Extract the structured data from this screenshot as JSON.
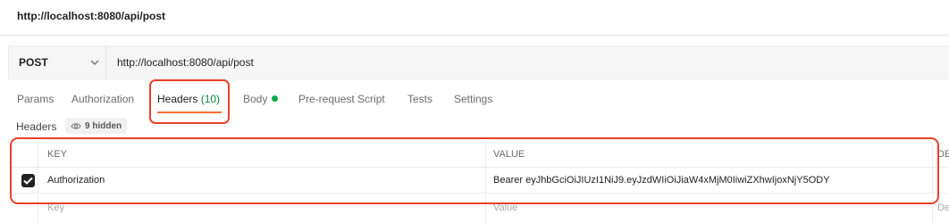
{
  "title": "http://localhost:8080/api/post",
  "request": {
    "method": "POST",
    "url": "http://localhost:8080/api/post"
  },
  "tabs": [
    {
      "label": "Params"
    },
    {
      "label": "Authorization"
    },
    {
      "label": "Headers",
      "count": "(10)"
    },
    {
      "label": "Body"
    },
    {
      "label": "Pre-request Script"
    },
    {
      "label": "Tests"
    },
    {
      "label": "Settings"
    }
  ],
  "headers_section": {
    "label": "Headers",
    "hidden_label": "9 hidden"
  },
  "table": {
    "columns": {
      "key": "KEY",
      "value": "VALUE",
      "description": "DE"
    },
    "rows": [
      {
        "key": "Authorization",
        "value": "Bearer eyJhbGciOiJIUzI1NiJ9.eyJzdWIiOiJiaW4xMjM0IiwiZXhwIjoxNjY5ODY",
        "checked": true
      }
    ],
    "placeholders": {
      "key": "Key",
      "value": "Value",
      "description": "De"
    }
  },
  "colors": {
    "highlight": "#e8402a",
    "active_underline": "#ff6c37",
    "count_green": "#0a8a3a",
    "body_dot": "#0ca94e"
  },
  "icons": [
    "chevron-down-icon",
    "eye-icon",
    "checkmark-icon"
  ]
}
